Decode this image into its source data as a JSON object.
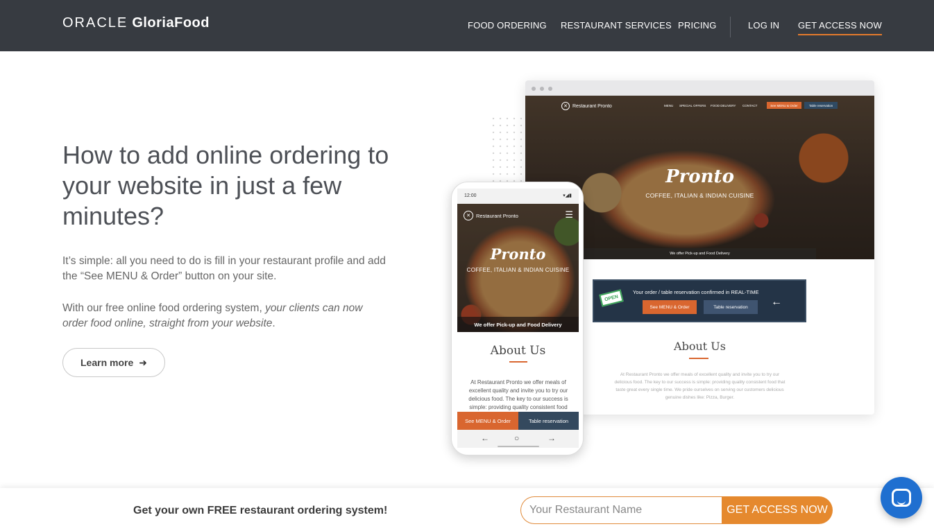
{
  "header": {
    "logo_oracle": "ORACLE",
    "logo_gloriafood": "GloriaFood",
    "nav": [
      "FOOD ORDERING",
      "RESTAURANT SERVICES",
      "PRICING"
    ],
    "login": "LOG IN",
    "cta": "GET ACCESS NOW",
    "accent_color": "#e57a2c"
  },
  "hero": {
    "title": "How to add online ordering to your website in just a few minutes?",
    "paragraph1": "It’s simple: all you need to do is fill in your restaurant profile and add the “See MENU & Order” button on your site.",
    "paragraph2_plain": "With our free online food ordering system, ",
    "paragraph2_italic": "your clients can now order food online, straight from your website",
    "paragraph2_end": ".",
    "learn_more": "Learn more",
    "learn_more_icon": "arrow-right-icon"
  },
  "desktop_mockup": {
    "brand": "Restaurant Pronto",
    "menu": [
      "MENU",
      "SPECIAL OFFERS",
      "FOOD DELIVERY",
      "CONTACT"
    ],
    "btn_order": "See MENU & Order",
    "btn_table": "Table reservation",
    "title": "Pronto",
    "subtitle": "COFFEE, ITALIAN & INDIAN CUISINE",
    "strip": "We offer Pick-up and Food Delivery",
    "banner_sign": "OPEN",
    "banner_text": "Your order / table reservation confirmed in REAL-TIME",
    "banner_btn_order": "See MENU & Order",
    "banner_btn_table": "Table reservation",
    "about_title": "About Us",
    "about_text": "At Restaurant Pronto we offer meals of excellent quality and invite you to try our delicious food. The key to our success is simple: providing quality consistent food that taste great every single time. We pride ourselves on serving our customers delicious genuine dishes like: Pizza, Burger."
  },
  "phone_mockup": {
    "time": "12:00",
    "brand": "Restaurant Pronto",
    "title": "Pronto",
    "subtitle": "COFFEE, ITALIAN & INDIAN CUISINE",
    "strip": "We offer Pick-up and Food Delivery",
    "about_title": "About Us",
    "about_text": "At Restaurant Pronto we offer meals of excellent quality and invite you to try our delicious food. The key to our success is simple: providing quality consistent food",
    "btn_order": "See MENU & Order",
    "btn_table": "Table reservation"
  },
  "cta_bar": {
    "text": "Get your own FREE restaurant ordering system!",
    "input_placeholder": "Your Restaurant Name",
    "button": "GET ACCESS NOW",
    "button_color": "#e5892e"
  },
  "chat": {
    "icon": "chat-bubble-icon",
    "color": "#1f6fd0"
  }
}
